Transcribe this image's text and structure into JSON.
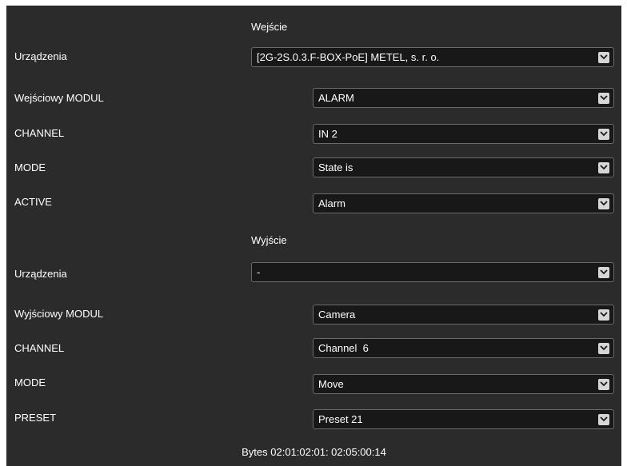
{
  "input": {
    "title": "Wejście",
    "device_label": "Urządzenia",
    "device_value": "[2G-2S.0.3.F-BOX-PoE] METEL, s. r. o.",
    "rows": [
      {
        "label": "Wejściowy MODUL",
        "value": "ALARM"
      },
      {
        "label": "CHANNEL",
        "value": "IN 2"
      },
      {
        "label": "MODE",
        "value": "State is"
      },
      {
        "label": "ACTIVE",
        "value": "Alarm"
      }
    ]
  },
  "output": {
    "title": "Wyjście",
    "device_label": "Urządzenia",
    "device_value": "-",
    "rows": [
      {
        "label": "Wyjściowy MODUL",
        "value": "Camera"
      },
      {
        "label": "CHANNEL",
        "value": "Channel  6"
      },
      {
        "label": "MODE",
        "value": "Move"
      },
      {
        "label": "PRESET",
        "value": "Preset 21"
      }
    ]
  },
  "footer": {
    "bytes_text": "Bytes 02:01:02:01: 02:05:00:14"
  },
  "colors": {
    "panel_bg": "#2b2b2b",
    "field_bg": "#181818",
    "field_border": "#6a6a6a",
    "chevron_bg": "#d6d6d6"
  },
  "icons": {
    "dropdown": "chevron-down-icon"
  }
}
